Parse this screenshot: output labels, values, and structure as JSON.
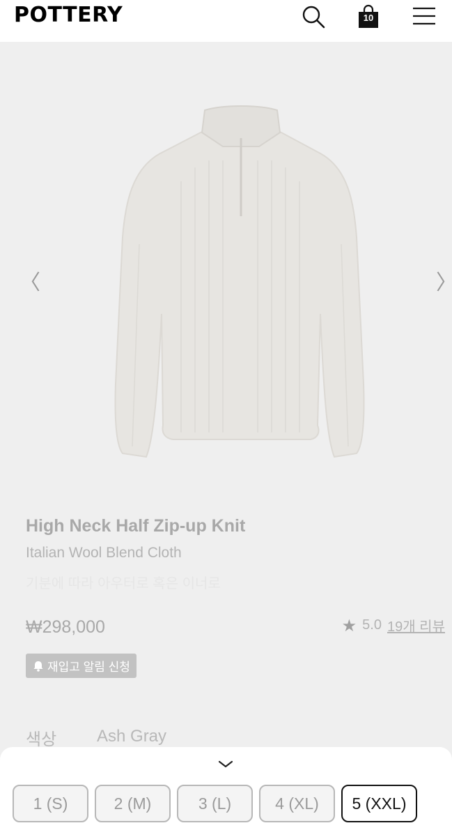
{
  "header": {
    "logo": "POTTERY",
    "cart_count": "10"
  },
  "product": {
    "image_icon": "sweater-image",
    "prev_arrow": "〈",
    "next_arrow": "〉",
    "name": "High Neck Half Zip-up Knit",
    "material": "Italian Wool Blend Cloth",
    "description": "기분에 따라 아우터로 혹은 이너로",
    "price": "₩298,000",
    "rating": "5.0",
    "reviews": "19개 리뷰",
    "restock_label": "재입고 알림 신청"
  },
  "option": {
    "label": "색상",
    "value": "Ash Gray"
  },
  "sheet": {
    "sizes": [
      {
        "label": "1 (S)"
      },
      {
        "label": "2 (M)"
      },
      {
        "label": "3 (L)"
      },
      {
        "label": "4 (XL)"
      },
      {
        "label": "5 (XXL)"
      }
    ],
    "selected_size": "5 (XXL)"
  },
  "colors": {
    "overlay": "#efefef",
    "active_border": "#111111"
  }
}
